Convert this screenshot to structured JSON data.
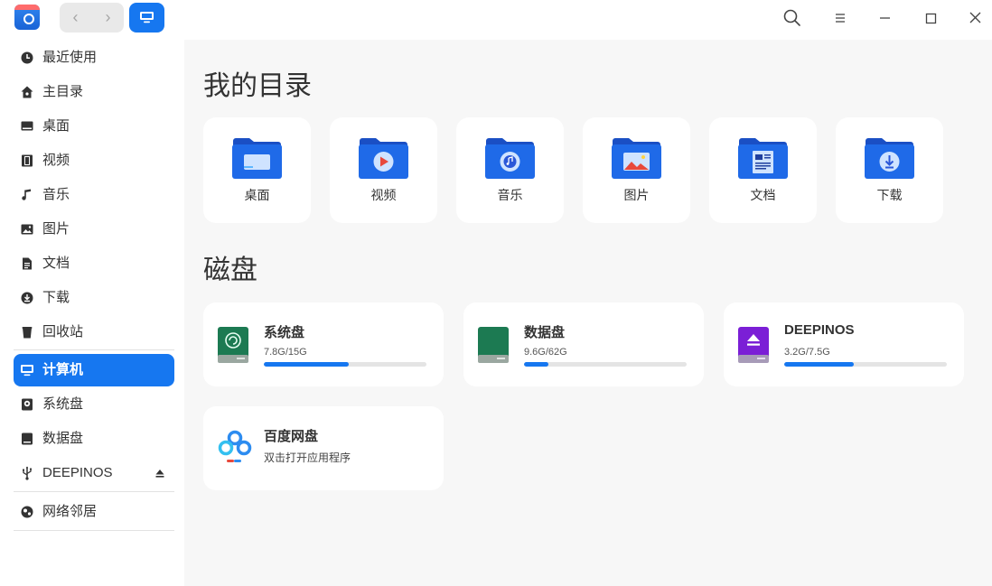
{
  "sidebar": {
    "items": [
      {
        "label": "最近使用",
        "icon": "clock-icon"
      },
      {
        "label": "主目录",
        "icon": "home-icon"
      },
      {
        "label": "桌面",
        "icon": "desktop-icon"
      },
      {
        "label": "视频",
        "icon": "film-icon"
      },
      {
        "label": "音乐",
        "icon": "music-note-icon"
      },
      {
        "label": "图片",
        "icon": "image-icon"
      },
      {
        "label": "文档",
        "icon": "document-icon"
      },
      {
        "label": "下载",
        "icon": "download-icon"
      },
      {
        "label": "回收站",
        "icon": "trash-icon"
      }
    ],
    "devices": [
      {
        "label": "计算机",
        "icon": "computer-icon",
        "active": true
      },
      {
        "label": "系统盘",
        "icon": "disk-icon"
      },
      {
        "label": "数据盘",
        "icon": "disk-icon"
      },
      {
        "label": "DEEPINOS",
        "icon": "usb-icon",
        "eject": true
      }
    ],
    "network": [
      {
        "label": "网络邻居",
        "icon": "network-icon"
      }
    ]
  },
  "main": {
    "dir_title": "我的目录",
    "folders": [
      {
        "label": "桌面",
        "icon": "desktop-folder-icon"
      },
      {
        "label": "视频",
        "icon": "video-folder-icon"
      },
      {
        "label": "音乐",
        "icon": "music-folder-icon"
      },
      {
        "label": "图片",
        "icon": "pictures-folder-icon"
      },
      {
        "label": "文档",
        "icon": "documents-folder-icon"
      },
      {
        "label": "下载",
        "icon": "downloads-folder-icon"
      }
    ],
    "disk_title": "磁盘",
    "disks": [
      {
        "name": "系统盘",
        "usage": "7.8G/15G",
        "used_fraction": 0.52,
        "color": "#1c7a52"
      },
      {
        "name": "数据盘",
        "usage": "9.6G/62G",
        "used_fraction": 0.15,
        "color": "#1c7a52"
      },
      {
        "name": "DEEPINOS",
        "usage": "3.2G/7.5G",
        "used_fraction": 0.43,
        "color": "#8a2be2"
      }
    ],
    "cloud": {
      "name": "百度网盘",
      "subtitle": "双击打开应用程序"
    }
  },
  "colors": {
    "accent": "#1677f0",
    "background": "#f7f7f7"
  }
}
